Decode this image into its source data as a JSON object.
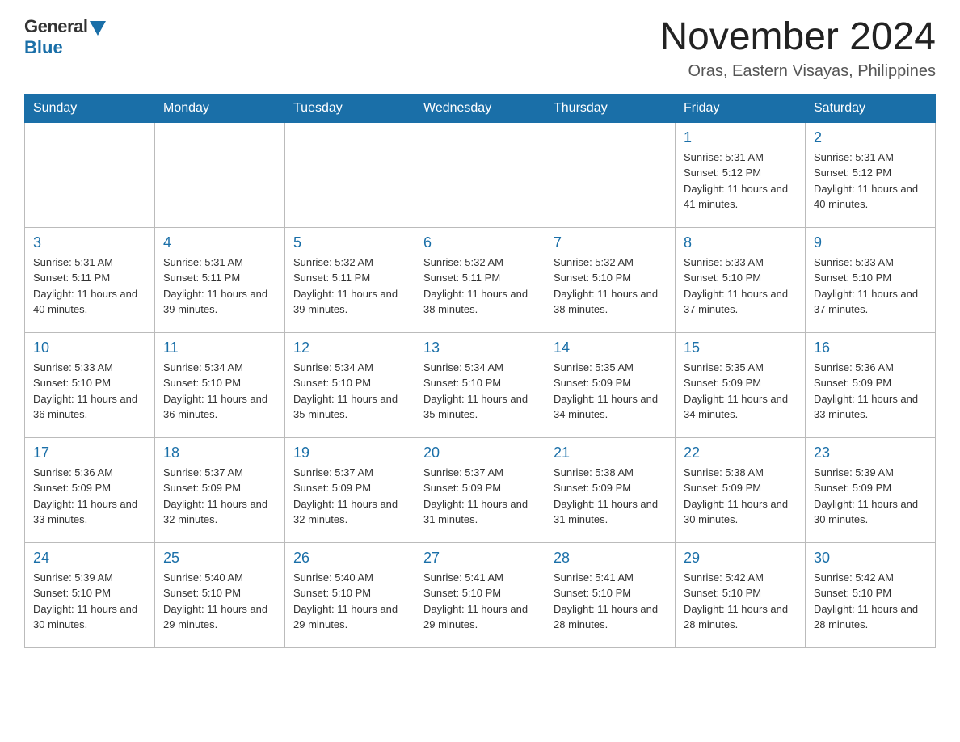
{
  "header": {
    "logo_general": "General",
    "logo_blue": "Blue",
    "main_title": "November 2024",
    "subtitle": "Oras, Eastern Visayas, Philippines"
  },
  "calendar": {
    "days_of_week": [
      "Sunday",
      "Monday",
      "Tuesday",
      "Wednesday",
      "Thursday",
      "Friday",
      "Saturday"
    ],
    "weeks": [
      [
        {
          "day": "",
          "info": ""
        },
        {
          "day": "",
          "info": ""
        },
        {
          "day": "",
          "info": ""
        },
        {
          "day": "",
          "info": ""
        },
        {
          "day": "",
          "info": ""
        },
        {
          "day": "1",
          "info": "Sunrise: 5:31 AM\nSunset: 5:12 PM\nDaylight: 11 hours and 41 minutes."
        },
        {
          "day": "2",
          "info": "Sunrise: 5:31 AM\nSunset: 5:12 PM\nDaylight: 11 hours and 40 minutes."
        }
      ],
      [
        {
          "day": "3",
          "info": "Sunrise: 5:31 AM\nSunset: 5:11 PM\nDaylight: 11 hours and 40 minutes."
        },
        {
          "day": "4",
          "info": "Sunrise: 5:31 AM\nSunset: 5:11 PM\nDaylight: 11 hours and 39 minutes."
        },
        {
          "day": "5",
          "info": "Sunrise: 5:32 AM\nSunset: 5:11 PM\nDaylight: 11 hours and 39 minutes."
        },
        {
          "day": "6",
          "info": "Sunrise: 5:32 AM\nSunset: 5:11 PM\nDaylight: 11 hours and 38 minutes."
        },
        {
          "day": "7",
          "info": "Sunrise: 5:32 AM\nSunset: 5:10 PM\nDaylight: 11 hours and 38 minutes."
        },
        {
          "day": "8",
          "info": "Sunrise: 5:33 AM\nSunset: 5:10 PM\nDaylight: 11 hours and 37 minutes."
        },
        {
          "day": "9",
          "info": "Sunrise: 5:33 AM\nSunset: 5:10 PM\nDaylight: 11 hours and 37 minutes."
        }
      ],
      [
        {
          "day": "10",
          "info": "Sunrise: 5:33 AM\nSunset: 5:10 PM\nDaylight: 11 hours and 36 minutes."
        },
        {
          "day": "11",
          "info": "Sunrise: 5:34 AM\nSunset: 5:10 PM\nDaylight: 11 hours and 36 minutes."
        },
        {
          "day": "12",
          "info": "Sunrise: 5:34 AM\nSunset: 5:10 PM\nDaylight: 11 hours and 35 minutes."
        },
        {
          "day": "13",
          "info": "Sunrise: 5:34 AM\nSunset: 5:10 PM\nDaylight: 11 hours and 35 minutes."
        },
        {
          "day": "14",
          "info": "Sunrise: 5:35 AM\nSunset: 5:09 PM\nDaylight: 11 hours and 34 minutes."
        },
        {
          "day": "15",
          "info": "Sunrise: 5:35 AM\nSunset: 5:09 PM\nDaylight: 11 hours and 34 minutes."
        },
        {
          "day": "16",
          "info": "Sunrise: 5:36 AM\nSunset: 5:09 PM\nDaylight: 11 hours and 33 minutes."
        }
      ],
      [
        {
          "day": "17",
          "info": "Sunrise: 5:36 AM\nSunset: 5:09 PM\nDaylight: 11 hours and 33 minutes."
        },
        {
          "day": "18",
          "info": "Sunrise: 5:37 AM\nSunset: 5:09 PM\nDaylight: 11 hours and 32 minutes."
        },
        {
          "day": "19",
          "info": "Sunrise: 5:37 AM\nSunset: 5:09 PM\nDaylight: 11 hours and 32 minutes."
        },
        {
          "day": "20",
          "info": "Sunrise: 5:37 AM\nSunset: 5:09 PM\nDaylight: 11 hours and 31 minutes."
        },
        {
          "day": "21",
          "info": "Sunrise: 5:38 AM\nSunset: 5:09 PM\nDaylight: 11 hours and 31 minutes."
        },
        {
          "day": "22",
          "info": "Sunrise: 5:38 AM\nSunset: 5:09 PM\nDaylight: 11 hours and 30 minutes."
        },
        {
          "day": "23",
          "info": "Sunrise: 5:39 AM\nSunset: 5:09 PM\nDaylight: 11 hours and 30 minutes."
        }
      ],
      [
        {
          "day": "24",
          "info": "Sunrise: 5:39 AM\nSunset: 5:10 PM\nDaylight: 11 hours and 30 minutes."
        },
        {
          "day": "25",
          "info": "Sunrise: 5:40 AM\nSunset: 5:10 PM\nDaylight: 11 hours and 29 minutes."
        },
        {
          "day": "26",
          "info": "Sunrise: 5:40 AM\nSunset: 5:10 PM\nDaylight: 11 hours and 29 minutes."
        },
        {
          "day": "27",
          "info": "Sunrise: 5:41 AM\nSunset: 5:10 PM\nDaylight: 11 hours and 29 minutes."
        },
        {
          "day": "28",
          "info": "Sunrise: 5:41 AM\nSunset: 5:10 PM\nDaylight: 11 hours and 28 minutes."
        },
        {
          "day": "29",
          "info": "Sunrise: 5:42 AM\nSunset: 5:10 PM\nDaylight: 11 hours and 28 minutes."
        },
        {
          "day": "30",
          "info": "Sunrise: 5:42 AM\nSunset: 5:10 PM\nDaylight: 11 hours and 28 minutes."
        }
      ]
    ]
  }
}
